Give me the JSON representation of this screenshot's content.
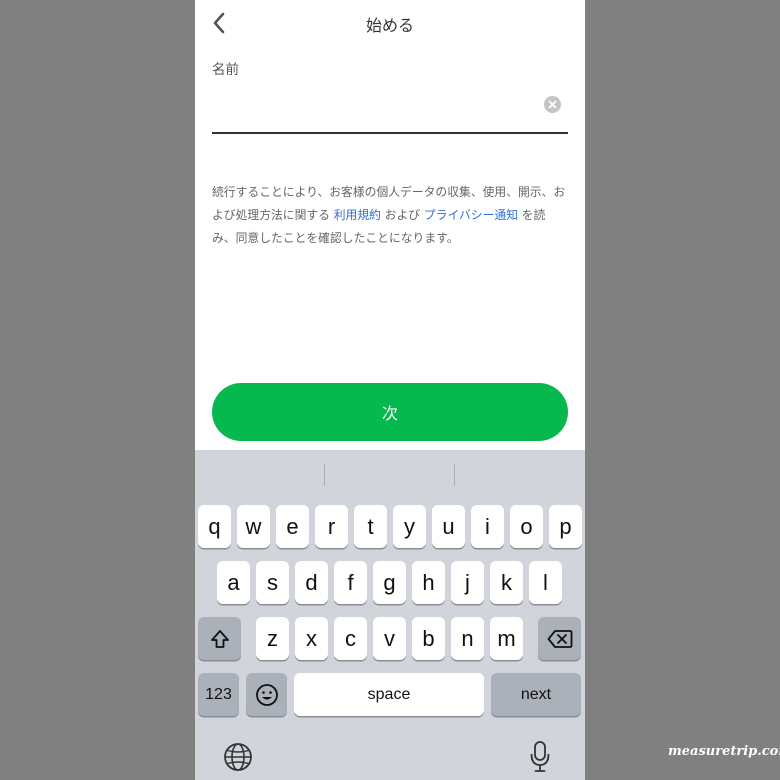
{
  "nav": {
    "title": "始める",
    "back_icon": "chevron-left-icon"
  },
  "form": {
    "name_label": "名前",
    "name_value": "",
    "clear_icon": "clear-circle-icon"
  },
  "consent": {
    "text_1": "続行することにより、お客様の個人データの収集、使用、開示、および処理方法に関する ",
    "terms_link": "利用規約",
    "text_2": " および ",
    "privacy_link": "プライバシー通知",
    "text_3": " を読み、同意したことを確認したことになります。"
  },
  "next_button": "次",
  "colors": {
    "accent": "#06b84e",
    "link": "#2f6fd8",
    "background": "#808080",
    "keyboard": "#d1d4db"
  },
  "keyboard": {
    "row1": [
      "q",
      "w",
      "e",
      "r",
      "t",
      "y",
      "u",
      "i",
      "o",
      "p"
    ],
    "row2": [
      "a",
      "s",
      "d",
      "f",
      "g",
      "h",
      "j",
      "k",
      "l"
    ],
    "row3": [
      "z",
      "x",
      "c",
      "v",
      "b",
      "n",
      "m"
    ],
    "numbers_key": "123",
    "space_key": "space",
    "next_key": "next",
    "icons": [
      "shift-icon",
      "delete-icon",
      "emoji-icon",
      "globe-icon",
      "mic-icon"
    ]
  },
  "watermark": "measuretrip.com"
}
